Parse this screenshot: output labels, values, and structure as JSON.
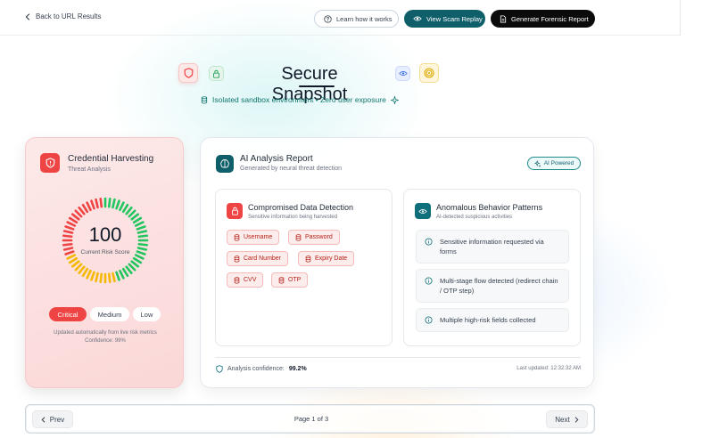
{
  "header": {
    "back_label": "Back to URL Results",
    "learn_label": "Learn how it works",
    "replay_label": "View Scam Replay",
    "report_label": "Generate Forensic Report"
  },
  "hero": {
    "title": "Secure Snapshot",
    "subtitle": "Isolated sandbox environment • Zero user exposure"
  },
  "threat_card": {
    "title": "Credential Harvesting",
    "subtitle": "Threat Analysis",
    "risk_score": "100",
    "risk_score_label": "Current Risk Score",
    "levels": [
      "Critical",
      "Medium",
      "Low"
    ],
    "selected_level": "Critical",
    "note_line1": "Updated automatically from live risk metrics",
    "note_line2": "Confidence: 99%",
    "colors": {
      "critical": "#ef4444",
      "warning": "#f5b800",
      "safe": "#22c55e"
    }
  },
  "analysis": {
    "title": "AI Analysis Report",
    "subtitle": "Generated by neural threat detection",
    "badge": "AI Powered",
    "compromised": {
      "title": "Compromised Data Detection",
      "subtitle": "Sensitive information being harvested",
      "tags": [
        "Username",
        "Password",
        "Card Number",
        "Expiry Date",
        "CVV",
        "OTP"
      ]
    },
    "anomalous": {
      "title": "Anomalous Behavior Patterns",
      "subtitle": "AI-detected suspicious activities",
      "items": [
        "Sensitive information requested via forms",
        "Multi-stage flow detected (redirect chain / OTP step)",
        "Multiple high-risk fields collected"
      ]
    },
    "confidence_label": "Analysis confidence:",
    "confidence_value": "99.2%",
    "last_updated": "Last updated: 12:32:32 AM"
  },
  "pager": {
    "prev_label": "Prev",
    "next_label": "Next",
    "page_label": "Page 1 of 3"
  }
}
